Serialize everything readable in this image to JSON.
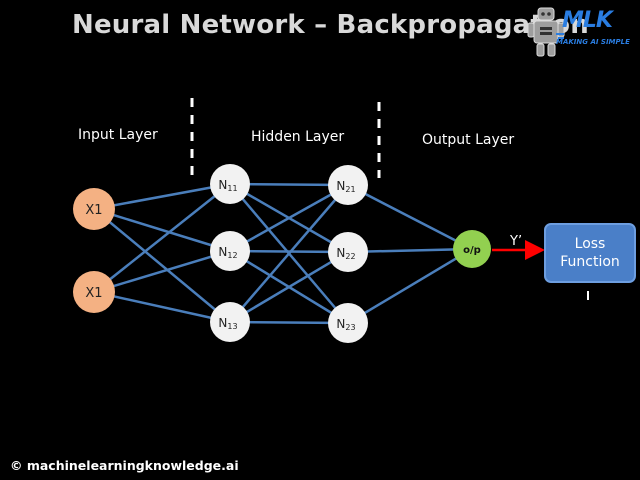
{
  "title": "Neural Network – Backpropagation",
  "logo": {
    "name": "MLK",
    "tagline": "MAKING AI SIMPLE"
  },
  "layers": {
    "input": "Input Layer",
    "hidden": "Hidden Layer",
    "output": "Output Layer"
  },
  "nodes": {
    "input": [
      "X1",
      "X1"
    ],
    "hidden1": [
      {
        "base": "N",
        "sub": "11"
      },
      {
        "base": "N",
        "sub": "12"
      },
      {
        "base": "N",
        "sub": "13"
      }
    ],
    "hidden2": [
      {
        "base": "N",
        "sub": "21"
      },
      {
        "base": "N",
        "sub": "22"
      },
      {
        "base": "N",
        "sub": "23"
      }
    ],
    "output": "o/p"
  },
  "prediction_label": "Y’",
  "loss": {
    "line1": "Loss",
    "line2": "Function"
  },
  "footer": "© machinelearningknowledge.ai",
  "colors": {
    "background": "#000000",
    "input_node": "#f4b183",
    "hidden_node": "#f2f2f2",
    "output_node": "#92d050",
    "connection": "#4a7ebb",
    "arrow": "#ff0000",
    "loss_box": "#4a7fc8"
  }
}
